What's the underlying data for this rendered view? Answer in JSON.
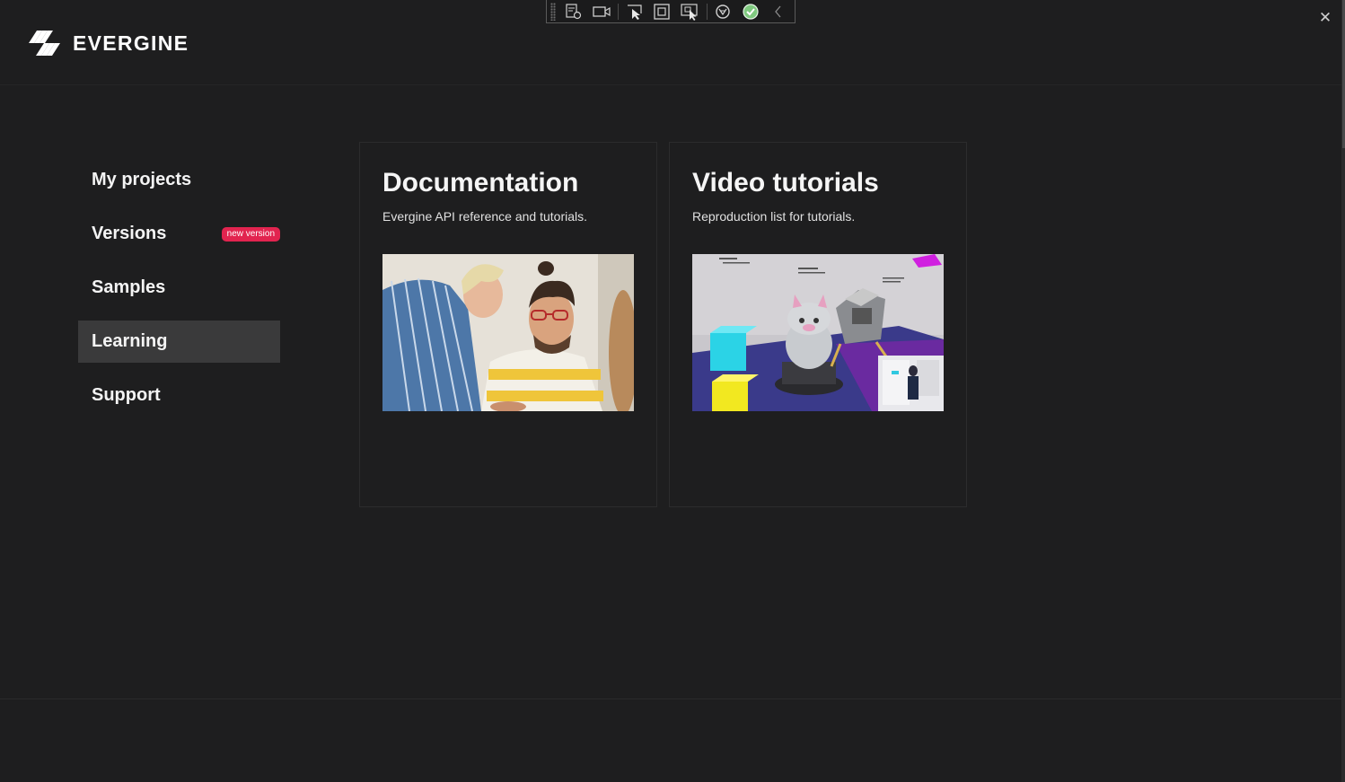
{
  "app": {
    "brand": "EVERGINE",
    "close_icon": "close-icon"
  },
  "toolbar": {
    "icons": [
      "live-visual-tree-icon",
      "record-icon",
      "select-element-icon",
      "display-layout-adorners-icon",
      "track-focused-element-icon",
      "hot-reload-icon",
      "check-icon",
      "collapse-chevron-icon"
    ]
  },
  "nav": {
    "items": [
      {
        "label": "My projects"
      },
      {
        "label": "Versions",
        "badge": "new version"
      },
      {
        "label": "Samples"
      },
      {
        "label": "Learning",
        "active": true
      },
      {
        "label": "Support"
      }
    ]
  },
  "cards": [
    {
      "title": "Documentation",
      "description": "Evergine API reference and tutorials."
    },
    {
      "title": "Video tutorials",
      "description": "Reproduction list for tutorials."
    }
  ],
  "colors": {
    "background": "#1e1e1f",
    "active_nav": "#3a3a3b",
    "badge": "#e2244f",
    "card_border": "#2c2c2d"
  }
}
